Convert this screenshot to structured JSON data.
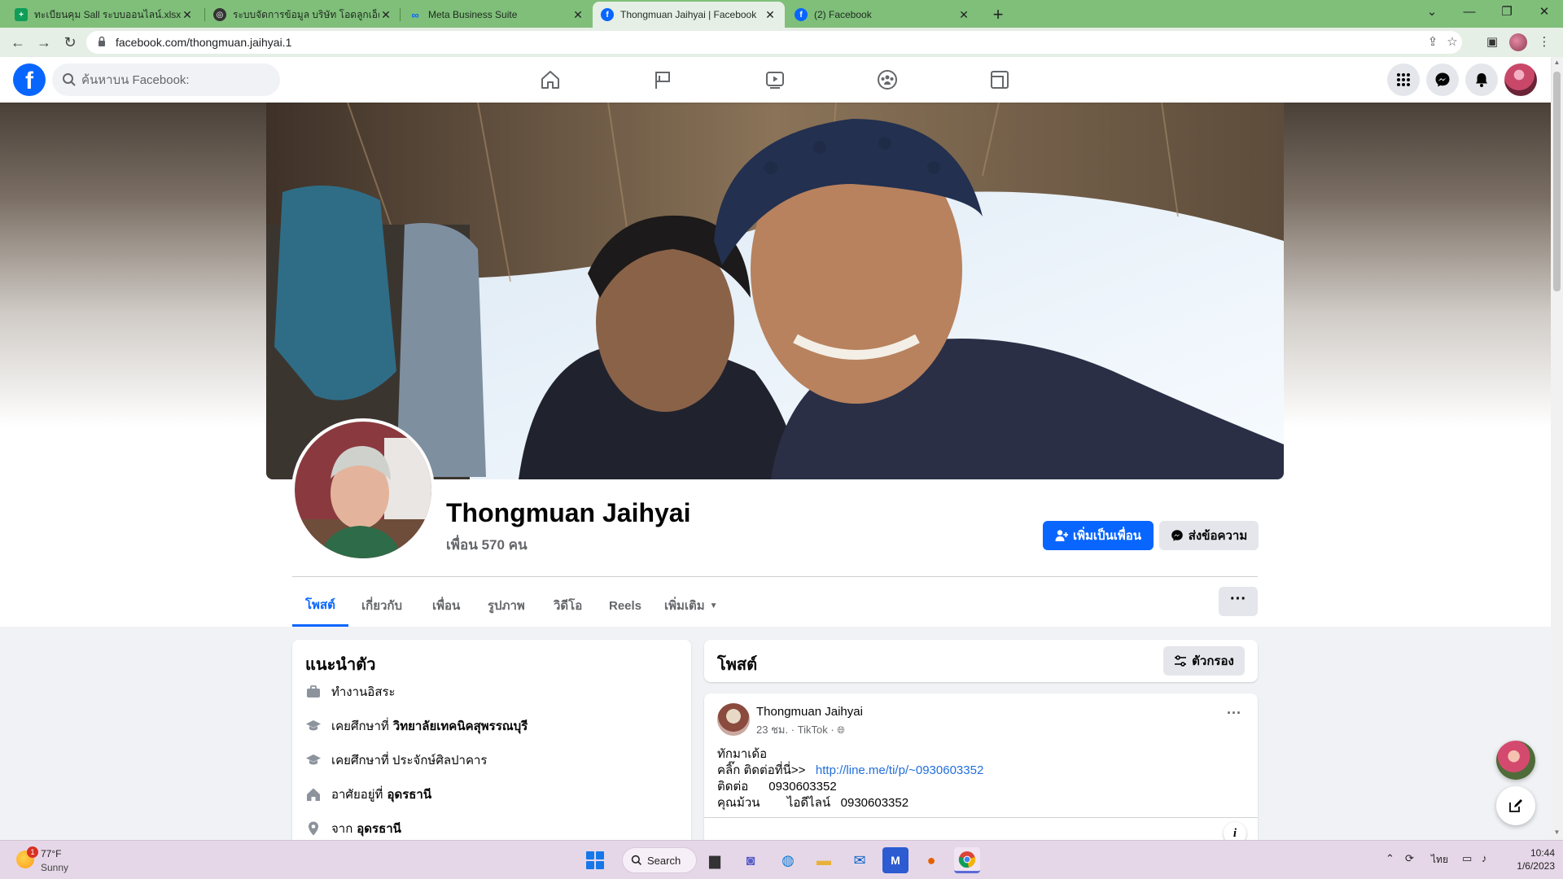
{
  "browser": {
    "tabs": [
      {
        "title": "ทะเบียนคุม Sall ระบบออนไลน์.xlsx - G",
        "icon": "sheets-icon",
        "color": "#0f9d58"
      },
      {
        "title": "ระบบจัดการข้อมูล บริษัท โอดลูกเอ็ด",
        "icon": "globe-icon",
        "color": "#333333"
      },
      {
        "title": "Meta Business Suite",
        "icon": "meta-icon",
        "color": "#0866ff"
      },
      {
        "title": "Thongmuan Jaihyai | Facebook",
        "icon": "facebook-icon",
        "color": "#0866ff"
      },
      {
        "title": "(2) Facebook",
        "icon": "facebook-icon",
        "color": "#0866ff"
      }
    ],
    "url": "facebook.com/thongmuan.jaihyai.1"
  },
  "fb": {
    "search_placeholder": "ค้นหาบน Facebook:",
    "accent": "#0866ff"
  },
  "profile": {
    "name": "Thongmuan Jaihyai",
    "friends": "เพื่อน 570 คน",
    "add_friend_label": "เพิ่มเป็นเพื่อน",
    "message_label": "ส่งข้อความ",
    "more_label": "···",
    "tabs": [
      "โพสต์",
      "เกี่ยวกับ",
      "เพื่อน",
      "รูปภาพ",
      "วิดีโอ",
      "Reels",
      "เพิ่มเติม"
    ]
  },
  "intro": {
    "title": "แนะนำตัว",
    "work": "ทำงานอิสระ",
    "edu1_prefix": "เคยศึกษาที่",
    "edu1_place": "วิทยาลัยเทคนิคสุพรรณบุรี",
    "edu2": "เคยศึกษาที่ ประจักษ์ศิลปาคาร",
    "lives_prefix": "อาศัยอยู่ที่",
    "lives_place": "อุดรธานี",
    "from_prefix": "จาก",
    "from_place": "อุดรธานี"
  },
  "posts": {
    "title": "โพสต์",
    "filter_label": "ตัวกรอง",
    "post": {
      "author": "Thongmuan Jaihyai",
      "meta": "23 ชม. · TikTok ·",
      "line1": "ทักมาเด้อ",
      "line2_prefix": "คลิ๊ก ติดต่อที่นี่>>",
      "line2_link": "http://line.me/ti/p/~0930603352",
      "line3": "ติดต่อ      0930603352",
      "line4": "คุณม้วน        ไอดีไลน์   0930603352"
    }
  },
  "taskbar": {
    "weather_badge": "1",
    "temp": "77°F",
    "condition": "Sunny",
    "search_label": "Search",
    "lang": "ไทย",
    "time": "10:44",
    "date": "1/6/2023"
  }
}
